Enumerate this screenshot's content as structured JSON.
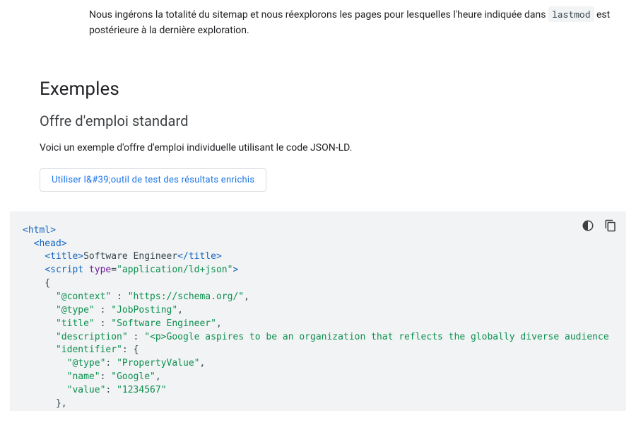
{
  "intro": {
    "line1": "Nous ingérons la totalité du sitemap et nous réexplorons les pages pour lesquelles l'heure indiquée dans",
    "code": "lastmod",
    "line2": " est postérieure à la dernière exploration."
  },
  "section_heading": "Exemples",
  "subsection_heading": "Offre d'emploi standard",
  "example_intro": "Voici un exemple d'offre d'emploi individuelle utilisant le code JSON-LD.",
  "test_button_label": "Utiliser l&#39;outil de test des résultats enrichis",
  "code_tokens": [
    {
      "c": "tag",
      "t": "<html>"
    },
    {
      "c": "nl"
    },
    {
      "c": "plain",
      "t": "  "
    },
    {
      "c": "tag",
      "t": "<head>"
    },
    {
      "c": "nl"
    },
    {
      "c": "plain",
      "t": "    "
    },
    {
      "c": "tag",
      "t": "<title>"
    },
    {
      "c": "plain",
      "t": "Software Engineer"
    },
    {
      "c": "tag",
      "t": "</title>"
    },
    {
      "c": "nl"
    },
    {
      "c": "plain",
      "t": "    "
    },
    {
      "c": "tag",
      "t": "<script "
    },
    {
      "c": "attr",
      "t": "type"
    },
    {
      "c": "punc",
      "t": "="
    },
    {
      "c": "str",
      "t": "\"application/ld+json\""
    },
    {
      "c": "tag",
      "t": ">"
    },
    {
      "c": "nl"
    },
    {
      "c": "plain",
      "t": "    {"
    },
    {
      "c": "nl"
    },
    {
      "c": "plain",
      "t": "      "
    },
    {
      "c": "str",
      "t": "\"@context\""
    },
    {
      "c": "plain",
      "t": " : "
    },
    {
      "c": "str",
      "t": "\"https://schema.org/\""
    },
    {
      "c": "plain",
      "t": ","
    },
    {
      "c": "nl"
    },
    {
      "c": "plain",
      "t": "      "
    },
    {
      "c": "str",
      "t": "\"@type\""
    },
    {
      "c": "plain",
      "t": " : "
    },
    {
      "c": "str",
      "t": "\"JobPosting\""
    },
    {
      "c": "plain",
      "t": ","
    },
    {
      "c": "nl"
    },
    {
      "c": "plain",
      "t": "      "
    },
    {
      "c": "str",
      "t": "\"title\""
    },
    {
      "c": "plain",
      "t": " : "
    },
    {
      "c": "str",
      "t": "\"Software Engineer\""
    },
    {
      "c": "plain",
      "t": ","
    },
    {
      "c": "nl"
    },
    {
      "c": "plain",
      "t": "      "
    },
    {
      "c": "str",
      "t": "\"description\""
    },
    {
      "c": "plain",
      "t": " : "
    },
    {
      "c": "str",
      "t": "\"<p>Google aspires to be an organization that reflects the globally diverse audience"
    },
    {
      "c": "nl"
    },
    {
      "c": "plain",
      "t": "      "
    },
    {
      "c": "str",
      "t": "\"identifier\""
    },
    {
      "c": "plain",
      "t": ": {"
    },
    {
      "c": "nl"
    },
    {
      "c": "plain",
      "t": "        "
    },
    {
      "c": "str",
      "t": "\"@type\""
    },
    {
      "c": "plain",
      "t": ": "
    },
    {
      "c": "str",
      "t": "\"PropertyValue\""
    },
    {
      "c": "plain",
      "t": ","
    },
    {
      "c": "nl"
    },
    {
      "c": "plain",
      "t": "        "
    },
    {
      "c": "str",
      "t": "\"name\""
    },
    {
      "c": "plain",
      "t": ": "
    },
    {
      "c": "str",
      "t": "\"Google\""
    },
    {
      "c": "plain",
      "t": ","
    },
    {
      "c": "nl"
    },
    {
      "c": "plain",
      "t": "        "
    },
    {
      "c": "str",
      "t": "\"value\""
    },
    {
      "c": "plain",
      "t": ": "
    },
    {
      "c": "str",
      "t": "\"1234567\""
    },
    {
      "c": "nl"
    },
    {
      "c": "plain",
      "t": "      },"
    }
  ],
  "icons": {
    "theme": "theme-toggle-icon",
    "copy": "copy-icon"
  }
}
